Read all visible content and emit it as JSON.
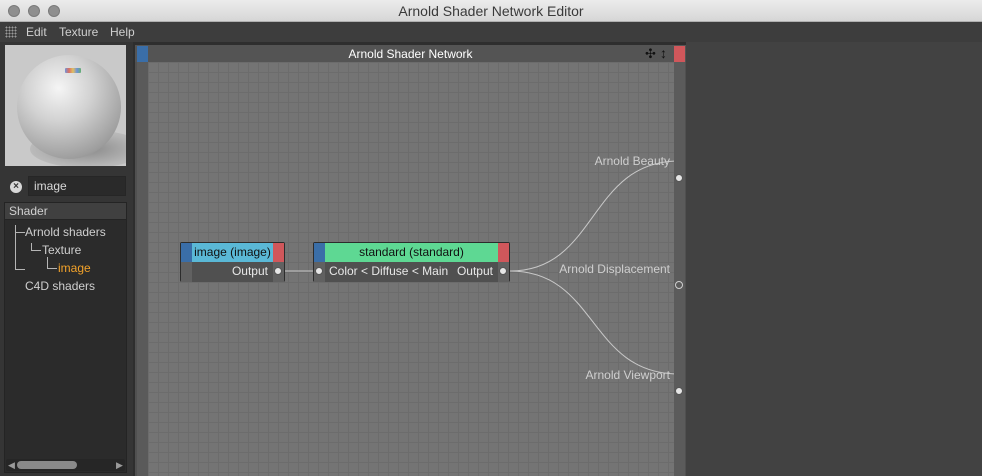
{
  "window": {
    "title": "Arnold Shader Network Editor"
  },
  "menu": {
    "items": [
      "Edit",
      "Texture",
      "Help"
    ]
  },
  "search": {
    "value": "image"
  },
  "tree": {
    "header": "Shader",
    "items": [
      {
        "label": "Arnold shaders",
        "level": 0
      },
      {
        "label": "Texture",
        "level": 1
      },
      {
        "label": "image",
        "level": 2,
        "selected": true
      },
      {
        "label": "C4D shaders",
        "level": 0
      }
    ]
  },
  "network": {
    "title": "Arnold Shader Network",
    "nodes": [
      {
        "title": "image (image)",
        "head_color": "#5ab8d6",
        "ports": {
          "output": "Output"
        }
      },
      {
        "title": "standard (standard)",
        "head_color": "#5ed893",
        "ports": {
          "input": "Color < Diffuse < Main",
          "output": "Output"
        }
      }
    ],
    "outputs": [
      {
        "label": "Arnold Beauty",
        "connected": true
      },
      {
        "label": "Arnold Displacement",
        "connected": false
      },
      {
        "label": "Arnold Viewport",
        "connected": true
      }
    ]
  },
  "colors": {
    "accent_blue": "#3a6ea8",
    "accent_red": "#d0575b",
    "selected_text": "#f2a22a"
  }
}
